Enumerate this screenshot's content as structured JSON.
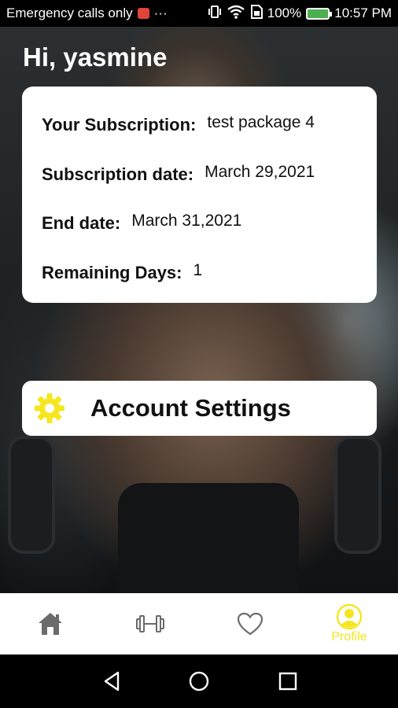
{
  "status_bar": {
    "carrier_text": "Emergency calls only",
    "more": "···",
    "battery_percent": "100%",
    "time": "10:57 PM"
  },
  "greeting": "Hi, yasmine",
  "subscription": {
    "rows": [
      {
        "label": "Your Subscription:",
        "value": "test package 4"
      },
      {
        "label": "Subscription date:",
        "value": "March 29,2021"
      },
      {
        "label": "End date:",
        "value": "March 31,2021"
      },
      {
        "label": "Remaining Days:",
        "value": "1"
      }
    ]
  },
  "settings": {
    "label": "Account Settings",
    "icon": "gear-icon"
  },
  "bottom_nav": {
    "items": [
      {
        "name": "home",
        "icon": "home-icon"
      },
      {
        "name": "workouts",
        "icon": "dumbbell-icon"
      },
      {
        "name": "favorites",
        "icon": "heart-icon"
      },
      {
        "name": "profile",
        "icon": "profile-icon",
        "label": "Profile",
        "active": true
      }
    ],
    "active_color": "#f5e61f",
    "inactive_color": "#6b6b6b"
  },
  "system_nav": {
    "buttons": [
      "back-icon",
      "home-circle-icon",
      "recents-icon"
    ]
  },
  "colors": {
    "accent": "#f5e61f",
    "card_bg": "#ffffff",
    "text_dark": "#111111"
  }
}
